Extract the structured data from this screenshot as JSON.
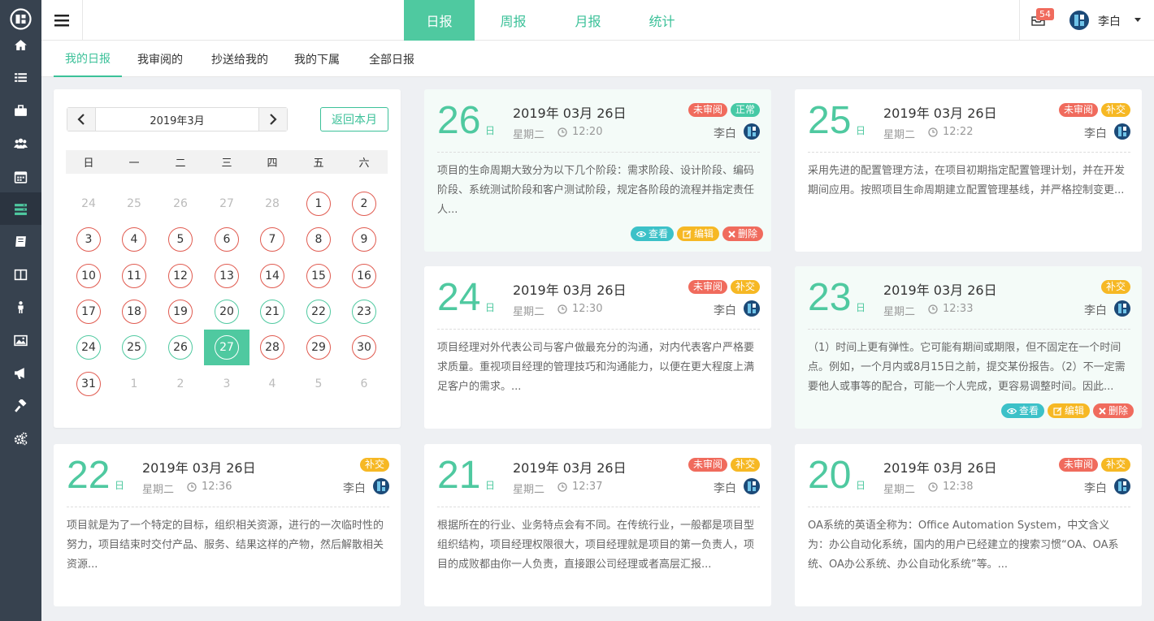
{
  "topnav": {
    "tabs": [
      {
        "label": "日报"
      },
      {
        "label": "周报"
      },
      {
        "label": "月报"
      },
      {
        "label": "统计"
      }
    ],
    "mail_count": "54",
    "user_name": "李白"
  },
  "sidebar": {
    "icons": [
      "home-icon",
      "list-icon",
      "briefcase-icon",
      "users-icon",
      "calendar-icon",
      "report-icon",
      "book-icon",
      "columns-icon",
      "person-icon",
      "image-icon",
      "megaphone-icon",
      "gavel-icon",
      "settings-icon"
    ]
  },
  "subnav": {
    "tabs": [
      {
        "label": "我的日报"
      },
      {
        "label": "我审阅的"
      },
      {
        "label": "抄送给我的"
      },
      {
        "label": "我的下属"
      },
      {
        "label": "全部日报"
      }
    ]
  },
  "calendar": {
    "month_label": "2019年3月",
    "back_label": "返回本月",
    "weekdays": [
      "日",
      "一",
      "二",
      "三",
      "四",
      "五",
      "六"
    ],
    "days": [
      "24",
      "25",
      "26",
      "27",
      "28",
      "1",
      "2",
      "3",
      "4",
      "5",
      "6",
      "7",
      "8",
      "9",
      "10",
      "11",
      "12",
      "13",
      "14",
      "15",
      "16",
      "17",
      "18",
      "19",
      "20",
      "21",
      "22",
      "23",
      "24",
      "25",
      "26",
      "27",
      "28",
      "29",
      "30",
      "31",
      "1",
      "2",
      "3",
      "4",
      "5",
      "6"
    ]
  },
  "reports": [
    {
      "day": "26",
      "day_suffix": "日",
      "date": "2019年 03月 26日",
      "weekday": "星期二",
      "time": "12:20",
      "badges": [
        "未审阅",
        "正常"
      ],
      "author": "李白",
      "text": "项目的生命周期大致分为以下几个阶段：需求阶段、设计阶段、编码阶段、系统测试阶段和客户测试阶段，规定各阶段的流程并指定责任人..."
    },
    {
      "day": "25",
      "day_suffix": "日",
      "date": "2019年 03月 26日",
      "weekday": "星期二",
      "time": "12:22",
      "badges": [
        "未审阅",
        "补交"
      ],
      "author": "李白",
      "text": "采用先进的配置管理方法，在项目初期指定配置管理计划，并在开发期间应用。按照项目生命周期建立配置管理基线，并严格控制变更..."
    },
    {
      "day": "24",
      "day_suffix": "日",
      "date": "2019年 03月 26日",
      "weekday": "星期二",
      "time": "12:30",
      "badges": [
        "未审阅",
        "补交"
      ],
      "author": "李白",
      "text": "项目经理对外代表公司与客户做最充分的沟通，对内代表客户严格要求质量。重视项目经理的管理技巧和沟通能力，以便在更大程度上满足客户的需求。..."
    },
    {
      "day": "23",
      "day_suffix": "日",
      "date": "2019年 03月 26日",
      "weekday": "星期二",
      "time": "12:33",
      "badges": [
        "补交"
      ],
      "author": "李白",
      "text": "（1）时间上更有弹性。它可能有期间或期限，但不固定在一个时间点。例如，一个月内或8月15日之前，提交某份报告。（2）不一定需要他人或事等的配合，可能一个人完成，更容易调整时间。因此..."
    },
    {
      "day": "22",
      "day_suffix": "日",
      "date": "2019年 03月 26日",
      "weekday": "星期二",
      "time": "12:36",
      "badges": [
        "补交"
      ],
      "author": "李白",
      "text": "项目就是为了一个特定的目标，组织相关资源，进行的一次临时性的努力，项目结束时交付产品、服务、结果这样的产物，然后解散相关资源..."
    },
    {
      "day": "21",
      "day_suffix": "日",
      "date": "2019年 03月 26日",
      "weekday": "星期二",
      "time": "12:37",
      "badges": [
        "未审阅",
        "补交"
      ],
      "author": "李白",
      "text": "根据所在的行业、业务特点会有不同。在传统行业，一般都是项目型组织结构，项目经理权限很大，项目经理就是项目的第一负责人，项目的成败都由你一人负责，直接跟公司经理或者高层汇报..."
    },
    {
      "day": "20",
      "day_suffix": "日",
      "date": "2019年 03月 26日",
      "weekday": "星期二",
      "time": "12:38",
      "badges": [
        "未审阅",
        "补交"
      ],
      "author": "李白",
      "text": "OA系统的英语全称为：Office Automation System，中文含义为：办公自动化系统，国内的用户已经建立的搜索习惯“OA、OA系统、OA办公系统、办公自动化系统”等。..."
    }
  ],
  "actions": {
    "view": "查看",
    "edit": "编辑",
    "delete": "删除"
  },
  "colors": {
    "accent": "#4fc9a0",
    "red": "#f06b5d",
    "orange": "#f6b824",
    "sidebar": "#37424f"
  }
}
